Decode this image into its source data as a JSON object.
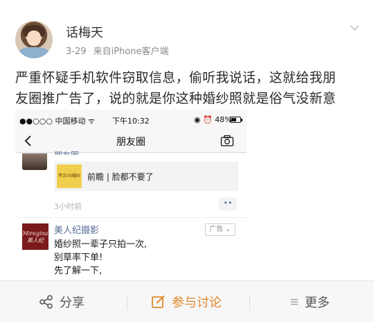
{
  "post": {
    "username": "话梅天",
    "date": "3-29",
    "source": "来自iPhone客户端",
    "text_line1": "严重怀疑手机软件窃取信息，偷听我说话，这就给我朋",
    "text_line2": "友圈推广告了，说的就是你这种婚纱照就是俗气没新意"
  },
  "screenshot": {
    "status": {
      "carrier": "●●○○○ 中国移动 ᯤ",
      "time": "下午10:32",
      "right": "◉ ⏰ 48%"
    },
    "nav": {
      "title": "朋友圈"
    },
    "feed": {
      "name_cut": "朋友圈",
      "link_thumb_text": "李文VS婚纱",
      "link_title": "前瞻 | 脸都不要了",
      "time": "3小时前",
      "dots": "••"
    },
    "ad": {
      "logo_text": "Miregina 美人纪",
      "name": "美人纪摄影",
      "badge": "广告 ⌄",
      "line1": "婚纱照一辈子只拍一次,",
      "line2": "别草率下单!",
      "line3": "先了解一下,"
    }
  },
  "actions": {
    "share": "分享",
    "discuss": "参与讨论",
    "more": "更多"
  },
  "colors": {
    "accent": "#e0882a",
    "wechat_link": "#576b95"
  }
}
